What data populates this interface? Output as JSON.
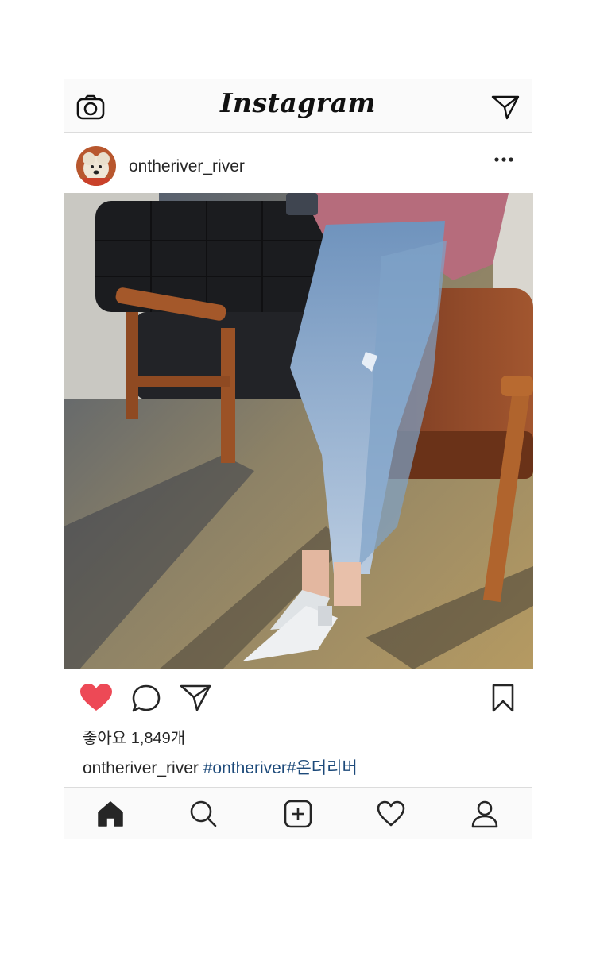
{
  "app": {
    "logo_text": "Instagram"
  },
  "header": {
    "camera_icon": "camera-icon",
    "direct_icon": "paper-plane-icon"
  },
  "post": {
    "username": "ontheriver_river",
    "more_icon": "more-dots-icon",
    "image_description_icon": "photo",
    "likes_text": "좋아요 1,849개",
    "caption_user": "ontheriver_river",
    "caption_tags": "#ontheriver#온더리버",
    "liked": true,
    "like_color": "#ed4956"
  },
  "tabbar": {
    "items": [
      "home-icon",
      "search-icon",
      "add-post-icon",
      "activity-heart-icon",
      "profile-icon"
    ]
  },
  "colors": {
    "hashtag": "#1d4a7a",
    "heart": "#ed4956",
    "bar_bg": "#fafafa",
    "divider": "#dcdcdc"
  }
}
